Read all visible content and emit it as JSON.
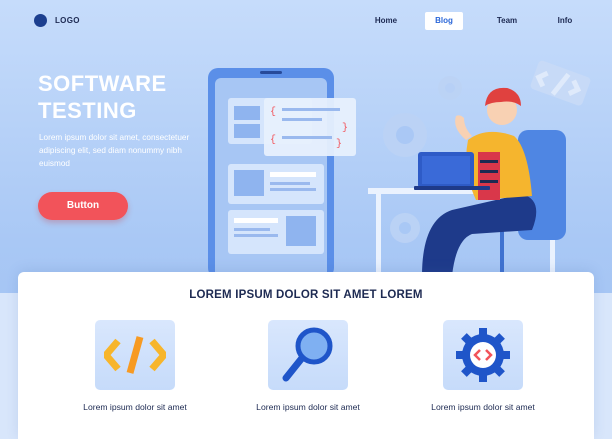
{
  "header": {
    "logo_text": "LOGO",
    "nav": [
      {
        "label": "Home",
        "active": false
      },
      {
        "label": "Blog",
        "active": true
      },
      {
        "label": "Team",
        "active": false
      },
      {
        "label": "Info",
        "active": false
      }
    ]
  },
  "hero": {
    "title_line1": "SOFTWARE",
    "title_line2": "TESTING",
    "subtitle": "Lorem ipsum dolor sit amet, consectetuer adipiscing elit, sed diam nonummy nibh euismod",
    "button_label": "Button"
  },
  "features": {
    "title": "LOREM IPSUM DOLOR SIT AMET LOREM",
    "items": [
      {
        "icon": "code-brackets-icon",
        "label": "Lorem ipsum dolor sit amet"
      },
      {
        "icon": "magnifier-icon",
        "label": "Lorem ipsum dolor sit amet"
      },
      {
        "icon": "gear-code-icon",
        "label": "Lorem ipsum dolor sit amet"
      }
    ]
  },
  "colors": {
    "accent": "#2a66d8",
    "button": "#f2535a",
    "navy": "#1d2a52",
    "icon_yellow": "#f7b52b"
  }
}
